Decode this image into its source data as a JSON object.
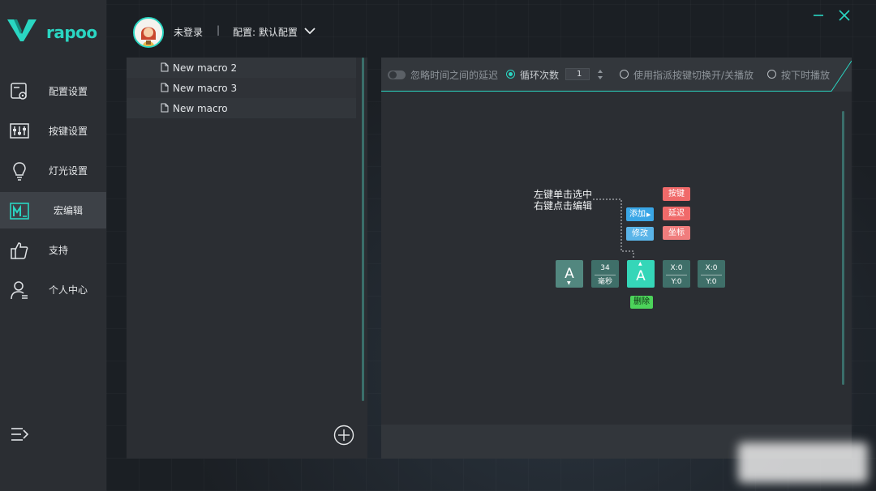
{
  "brand": {
    "name": "rapoo",
    "accent": "#2ad6c2"
  },
  "header": {
    "user_name": "未登录",
    "separator": "|",
    "config_label": "配置: 默认配置"
  },
  "sidebar": {
    "items": [
      {
        "label": "配置设置",
        "icon": "config-file-icon"
      },
      {
        "label": "按键设置",
        "icon": "sliders-icon"
      },
      {
        "label": "灯光设置",
        "icon": "bulb-icon"
      },
      {
        "label": "宏编辑",
        "icon": "macro-m-icon",
        "active": true
      },
      {
        "label": "支持",
        "icon": "thumbs-up-icon"
      },
      {
        "label": "个人中心",
        "icon": "user-icon"
      }
    ]
  },
  "macros": [
    {
      "name": "New macro 2"
    },
    {
      "name": "New macro 3"
    },
    {
      "name": "New macro"
    }
  ],
  "toolbar": {
    "ignore_delay_label": "忽略时间之间的延迟",
    "loop_label": "循环次数",
    "loop_count": "1",
    "toggle_label": "使用指派按键切换开/关播放",
    "hold_label": "按下时播放"
  },
  "tutorial": {
    "hint_line1": "左键单击选中",
    "hint_line2": "右键点击编辑",
    "add_label": "添加",
    "modify_label": "修改",
    "key_label": "按键",
    "delay_label": "延迟",
    "coord_label": "坐标",
    "delete_label": "删除",
    "block_key": "A",
    "block_delay_value": "34",
    "block_delay_unit": "毫秒",
    "block_selected": "A",
    "coord1_x": "X:0",
    "coord1_y": "Y:0",
    "coord2_x": "X:0",
    "coord2_y": "Y:0"
  }
}
